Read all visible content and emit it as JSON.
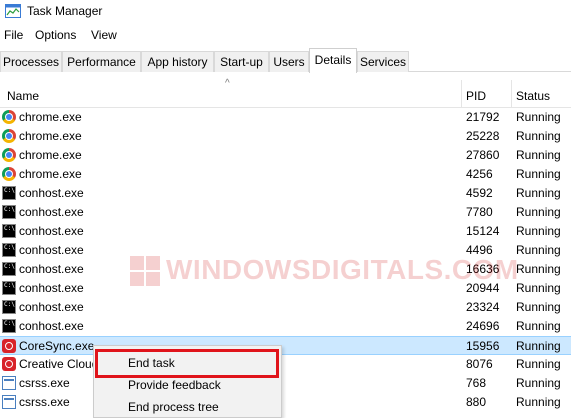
{
  "window": {
    "title": "Task Manager"
  },
  "menu": [
    "File",
    "Options",
    "View"
  ],
  "tabs": [
    {
      "label": "Processes",
      "active": false
    },
    {
      "label": "Performance",
      "active": false
    },
    {
      "label": "App history",
      "active": false
    },
    {
      "label": "Start-up",
      "active": false
    },
    {
      "label": "Users",
      "active": false
    },
    {
      "label": "Details",
      "active": true
    },
    {
      "label": "Services",
      "active": false
    }
  ],
  "columns": {
    "name": "Name",
    "pid": "PID",
    "status": "Status"
  },
  "rows": [
    {
      "icon": "chrome-icon",
      "name": "chrome.exe",
      "pid": "21792",
      "status": "Running",
      "selected": false
    },
    {
      "icon": "chrome-icon",
      "name": "chrome.exe",
      "pid": "25228",
      "status": "Running",
      "selected": false
    },
    {
      "icon": "chrome-icon",
      "name": "chrome.exe",
      "pid": "27860",
      "status": "Running",
      "selected": false
    },
    {
      "icon": "chrome-icon",
      "name": "chrome.exe",
      "pid": "4256",
      "status": "Running",
      "selected": false
    },
    {
      "icon": "console-icon",
      "name": "conhost.exe",
      "pid": "4592",
      "status": "Running",
      "selected": false
    },
    {
      "icon": "console-icon",
      "name": "conhost.exe",
      "pid": "7780",
      "status": "Running",
      "selected": false
    },
    {
      "icon": "console-icon",
      "name": "conhost.exe",
      "pid": "15124",
      "status": "Running",
      "selected": false
    },
    {
      "icon": "console-icon",
      "name": "conhost.exe",
      "pid": "4496",
      "status": "Running",
      "selected": false
    },
    {
      "icon": "console-icon",
      "name": "conhost.exe",
      "pid": "16636",
      "status": "Running",
      "selected": false
    },
    {
      "icon": "console-icon",
      "name": "conhost.exe",
      "pid": "20944",
      "status": "Running",
      "selected": false
    },
    {
      "icon": "console-icon",
      "name": "conhost.exe",
      "pid": "23324",
      "status": "Running",
      "selected": false
    },
    {
      "icon": "console-icon",
      "name": "conhost.exe",
      "pid": "24696",
      "status": "Running",
      "selected": false
    },
    {
      "icon": "adobe-icon",
      "name": "CoreSync.exe",
      "pid": "15956",
      "status": "Running",
      "selected": true
    },
    {
      "icon": "adobe-icon",
      "name": "Creative Cloud",
      "pid": "8076",
      "status": "Running",
      "selected": false
    },
    {
      "icon": "system-process-icon",
      "name": "csrss.exe",
      "pid": "768",
      "status": "Running",
      "selected": false
    },
    {
      "icon": "system-process-icon",
      "name": "csrss.exe",
      "pid": "880",
      "status": "Running",
      "selected": false
    }
  ],
  "context_menu": [
    "End task",
    "Provide feedback",
    "End process tree"
  ],
  "watermark": "WindowsDigitals.com",
  "colors": {
    "selected_row": "#cce8ff",
    "highlight_border": "#e0141b",
    "menu_bg": "#f2f2f2"
  }
}
